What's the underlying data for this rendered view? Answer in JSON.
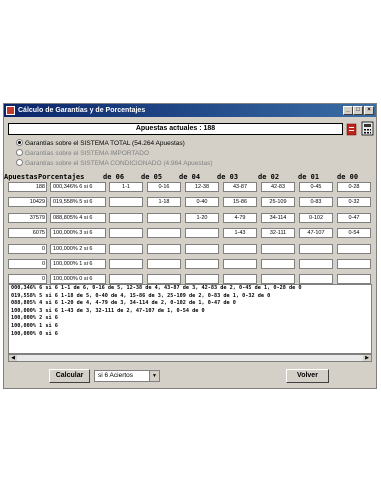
{
  "window": {
    "title": "Cálculo de Garantías y de Porcentajes",
    "controls": {
      "minimize": "_",
      "maximize": "□",
      "close": "×"
    }
  },
  "header": {
    "apuestas_actuales": "Apuestas actuales : 188"
  },
  "icons": {
    "delete": "red-document-icon",
    "calculator": "calculator-icon"
  },
  "options": [
    {
      "label": "Garantías sobre el SISTEMA TOTAL (54.264 Apuestas)",
      "selected": true,
      "enabled": true
    },
    {
      "label": "Garantías sobre el SISTEMA IMPORTADO",
      "selected": false,
      "enabled": false
    },
    {
      "label": "Garantías sobre el SISTEMA CONDICIONADO (4.964 Apuestas)",
      "selected": false,
      "enabled": false
    }
  ],
  "table": {
    "headers": [
      "Apuestas",
      "Porcentajes",
      "de 06",
      "de 05",
      "de 04",
      "de 03",
      "de 02",
      "de 01",
      "de 00"
    ],
    "rows": [
      [
        "188",
        "000,346% 6 si 6",
        "1-1",
        "0-16",
        "12-38",
        "43-87",
        "42-83",
        "0-45",
        "0-28"
      ],
      [
        "10429",
        "019,558% 5 si 6",
        "",
        "1-18",
        "0-40",
        "15-86",
        "25-109",
        "0-83",
        "0-32"
      ],
      [
        "37579",
        "088,805% 4 si 6",
        "",
        "",
        "1-20",
        "4-79",
        "34-114",
        "0-102",
        "0-47"
      ],
      [
        "6075",
        "100,000% 3 si 6",
        "",
        "",
        "",
        "1-43",
        "32-111",
        "47-107",
        "0-54"
      ],
      [
        "0",
        "100,000% 2 si 6",
        "",
        "",
        "",
        "",
        "",
        "",
        ""
      ],
      [
        "0",
        "100,000% 1 si 6",
        "",
        "",
        "",
        "",
        "",
        "",
        ""
      ],
      [
        "0",
        "100,000% 0 si 6",
        "",
        "",
        "",
        "",
        "",
        "",
        ""
      ]
    ]
  },
  "results": [
    "000,346% 6 si 6  1-1 de 6, 0-16 de 5, 12-38 de 4, 43-87 de 3, 42-83 de 2, 0-45 de 1, 0-28 de 0",
    "019,558% 5 si 6  1-18 de 5, 0-40 de 4, 15-86 de 3, 25-109 de 2, 0-83 de 1, 0-32 de 0",
    "088,805% 4 si 6  1-20 de 4, 4-79 de 3, 34-114 de 2, 0-102 de 1, 0-47 de 0",
    "100,000% 3 si 6  1-43 de 3, 32-111 de 2, 47-107 de 1, 0-54 de 0",
    "100,000% 2 si 6",
    "100,000% 1 si 6",
    "100,000% 0 si 6"
  ],
  "footer": {
    "calcular": "Calcular",
    "select_value": "si 6 Aciertos",
    "volver": "Volver"
  }
}
